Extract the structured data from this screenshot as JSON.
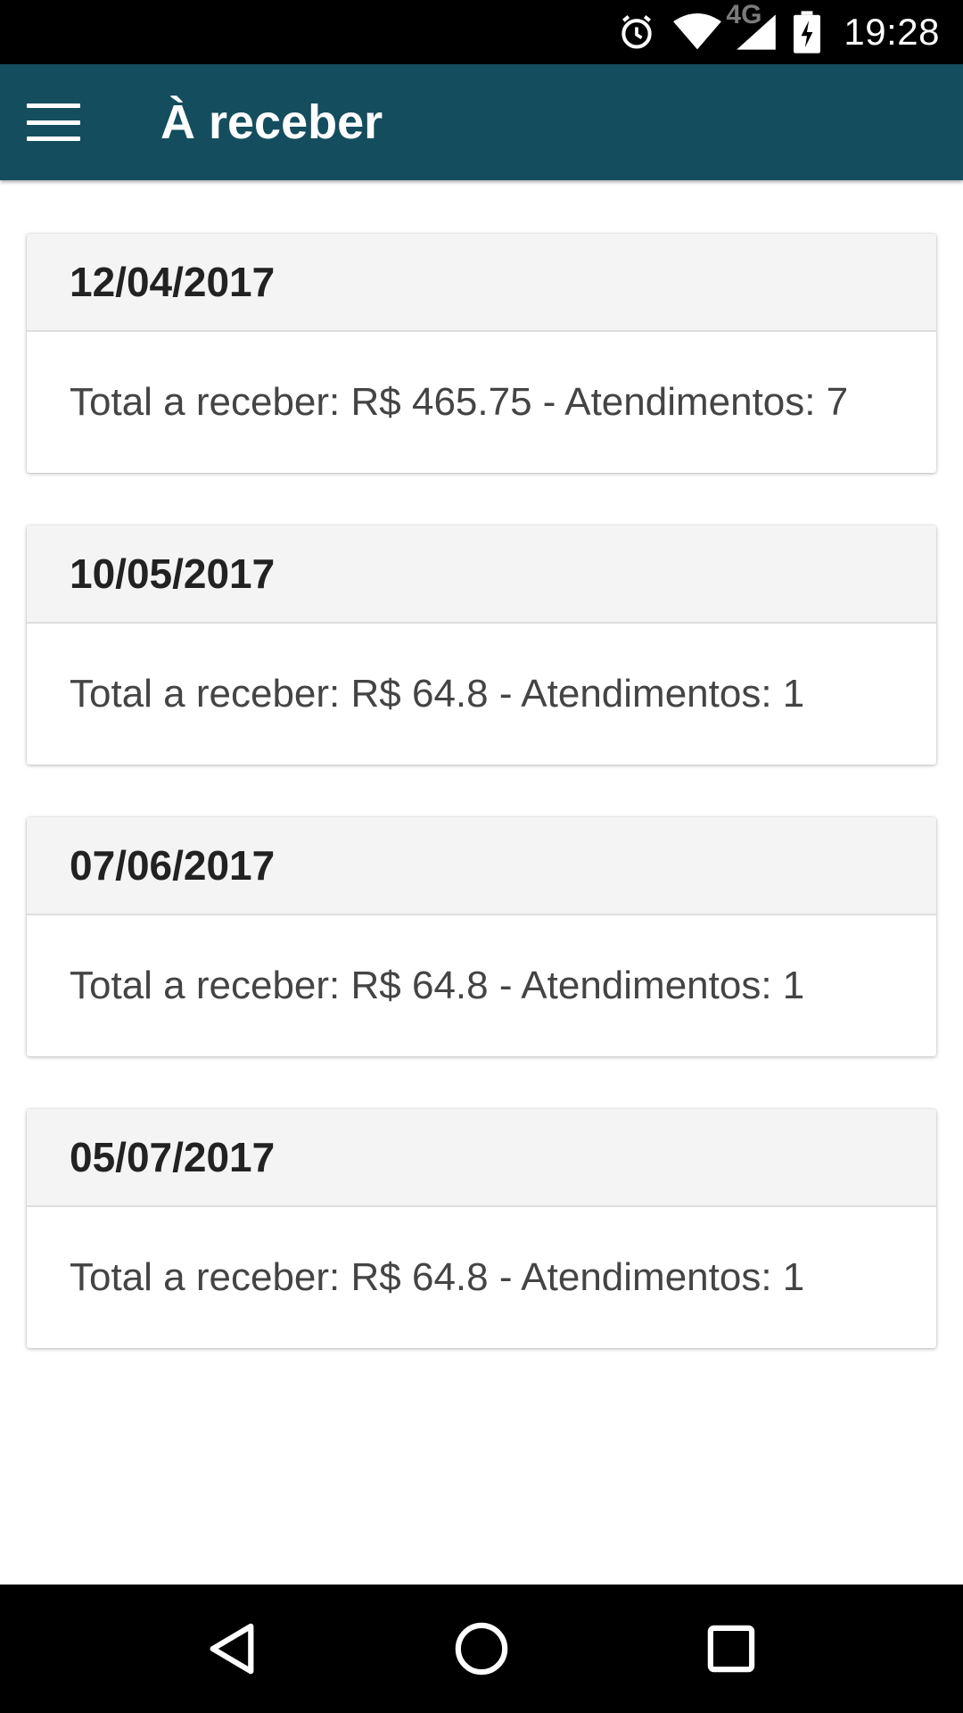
{
  "status_bar": {
    "network_label": "4G",
    "time": "19:28",
    "icons": [
      "alarm-icon",
      "wifi-icon",
      "cell-signal-icon",
      "battery-charging-icon"
    ]
  },
  "app_bar": {
    "title": "À receber",
    "menu_icon": "hamburger-menu-icon",
    "color": "#144e5e"
  },
  "cards": [
    {
      "date": "12/04/2017",
      "summary": "Total a receber: R$ 465.75 - Atendimentos: 7"
    },
    {
      "date": "10/05/2017",
      "summary": "Total a receber: R$ 64.8 - Atendimentos: 1"
    },
    {
      "date": "07/06/2017",
      "summary": "Total a receber: R$ 64.8 - Atendimentos: 1"
    },
    {
      "date": "05/07/2017",
      "summary": "Total a receber: R$ 64.8 - Atendimentos: 1"
    }
  ],
  "nav_bar": {
    "icons": [
      "back-icon",
      "home-icon",
      "recents-icon"
    ]
  }
}
